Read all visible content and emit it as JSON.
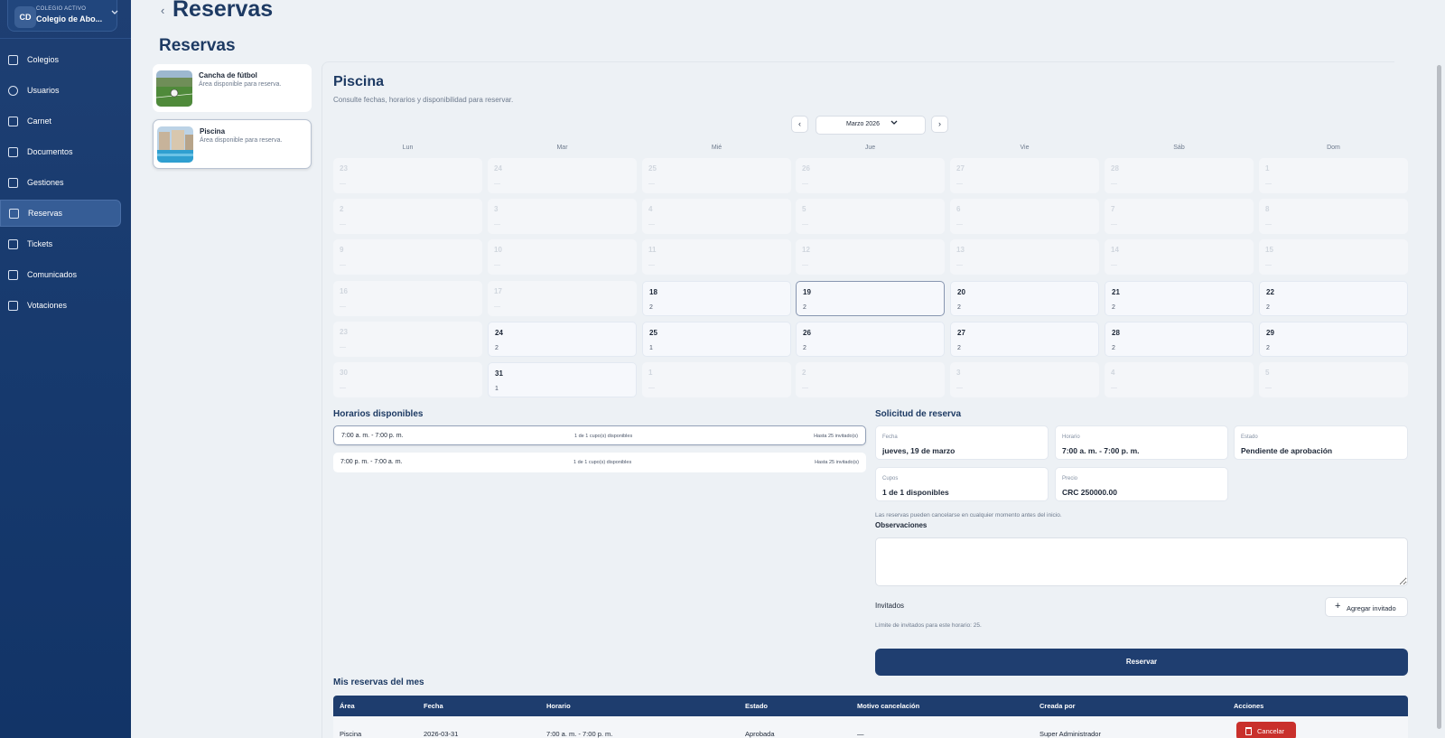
{
  "sidebar": {
    "school": {
      "badge": "CD",
      "label": "COLEGIO ACTIVO",
      "name": "Colegio de Abo...",
      "chevron": "chevron-down-icon"
    },
    "items": [
      {
        "label": "Colegios",
        "icon": "building-icon"
      },
      {
        "label": "Usuarios",
        "icon": "users-icon"
      },
      {
        "label": "Carnet",
        "icon": "id-card-icon"
      },
      {
        "label": "Documentos",
        "icon": "document-icon"
      },
      {
        "label": "Gestiones",
        "icon": "clipboard-icon"
      },
      {
        "label": "Reservas",
        "icon": "calendar-icon",
        "active": true
      },
      {
        "label": "Tickets",
        "icon": "ticket-icon"
      },
      {
        "label": "Comunicados",
        "icon": "megaphone-icon"
      },
      {
        "label": "Votaciones",
        "icon": "ballot-icon"
      }
    ]
  },
  "page": {
    "back_icon": "‹",
    "heading": "Reservas",
    "section_title": "Reservas"
  },
  "areas": [
    {
      "name": "Cancha de fútbol",
      "desc": "Área disponible para reserva."
    },
    {
      "name": "Piscina",
      "desc": "Área disponible para reserva."
    }
  ],
  "detail": {
    "title": "Piscina",
    "subtitle": "Consulte fechas, horarios y disponibilidad para reservar.",
    "month": "Marzo 2026",
    "prev": "‹",
    "next": "›"
  },
  "calendar": {
    "days_of_week": [
      "Lun",
      "Mar",
      "Mié",
      "Jue",
      "Vie",
      "Sáb",
      "Dom"
    ],
    "weeks": [
      [
        [
          "23",
          "—",
          "out"
        ],
        [
          "24",
          "—",
          "out"
        ],
        [
          "25",
          "—",
          "out"
        ],
        [
          "26",
          "—",
          "out"
        ],
        [
          "27",
          "—",
          "out"
        ],
        [
          "28",
          "—",
          "out"
        ],
        [
          "1",
          "—",
          "out"
        ]
      ],
      [
        [
          "2",
          "—",
          "out"
        ],
        [
          "3",
          "—",
          "out"
        ],
        [
          "4",
          "—",
          "out"
        ],
        [
          "5",
          "—",
          "out"
        ],
        [
          "6",
          "—",
          "out"
        ],
        [
          "7",
          "—",
          "out"
        ],
        [
          "8",
          "—",
          "out"
        ]
      ],
      [
        [
          "9",
          "—",
          "out"
        ],
        [
          "10",
          "—",
          "out"
        ],
        [
          "11",
          "—",
          "out"
        ],
        [
          "12",
          "—",
          "out"
        ],
        [
          "13",
          "—",
          "out"
        ],
        [
          "14",
          "—",
          "out"
        ],
        [
          "15",
          "—",
          "out"
        ]
      ],
      [
        [
          "16",
          "—",
          "out"
        ],
        [
          "17",
          "—",
          "out"
        ],
        [
          "18",
          "2",
          "avail"
        ],
        [
          "19",
          "2",
          "sel"
        ],
        [
          "20",
          "2",
          "avail"
        ],
        [
          "21",
          "2",
          "avail"
        ],
        [
          "22",
          "2",
          "avail"
        ]
      ],
      [
        [
          "23",
          "—",
          "out"
        ],
        [
          "24",
          "2",
          "avail"
        ],
        [
          "25",
          "1",
          "avail"
        ],
        [
          "26",
          "2",
          "avail"
        ],
        [
          "27",
          "2",
          "avail"
        ],
        [
          "28",
          "2",
          "avail"
        ],
        [
          "29",
          "2",
          "avail"
        ]
      ],
      [
        [
          "30",
          "—",
          "out"
        ],
        [
          "31",
          "1",
          "avail"
        ],
        [
          "1",
          "—",
          "out"
        ],
        [
          "2",
          "—",
          "out"
        ],
        [
          "3",
          "—",
          "out"
        ],
        [
          "4",
          "—",
          "out"
        ],
        [
          "5",
          "—",
          "out"
        ]
      ]
    ]
  },
  "schedules": {
    "title": "Horarios disponibles",
    "items": [
      {
        "time": "7:00 a. m. - 7:00 p. m.",
        "cupo": "1 de 1 cupo(s) disponibles",
        "limit": "Hasta 25 invitado(s)"
      },
      {
        "time": "7:00 p. m. - 7:00 a. m.",
        "cupo": "1 de 1 cupo(s) disponibles",
        "limit": "Hasta 25 invitado(s)"
      }
    ]
  },
  "request": {
    "title": "Solicitud de reserva",
    "fields": [
      {
        "label": "Fecha",
        "value": "jueves, 19 de marzo"
      },
      {
        "label": "Horario",
        "value": "7:00 a. m. - 7:00 p. m."
      },
      {
        "label": "Estado",
        "value": "Pendiente de aprobación"
      },
      {
        "label": "Cupos",
        "value": "1 de 1 disponibles"
      },
      {
        "label": "Precio",
        "value": "CRC 250000.00"
      }
    ],
    "note": "Las reservas pueden cancelarse en cualquier momento antes del inicio.",
    "obs_label": "Observaciones",
    "obs_value": "",
    "guests_label": "Invitados",
    "add_guest": "Agregar invitado",
    "guest_limit": "Límite de invitados para este horario: 25.",
    "submit": "Reservar"
  },
  "my_reservations": {
    "title": "Mis reservas del mes",
    "columns": [
      "Área",
      "Fecha",
      "Horario",
      "Estado",
      "Motivo cancelación",
      "Creada por",
      "Acciones"
    ],
    "rows": [
      {
        "area": "Piscina",
        "fecha": "2026-03-31",
        "horario": "7:00 a. m. - 7:00 p. m.",
        "estado": "Aprobada",
        "motivo": "—",
        "creada": "Super Administrador",
        "accion": "Cancelar"
      }
    ]
  },
  "colors": {
    "primary": "#1f3e70",
    "sidebar": "#1a3c70",
    "danger": "#c9302c",
    "bg": "#edf1f5"
  }
}
